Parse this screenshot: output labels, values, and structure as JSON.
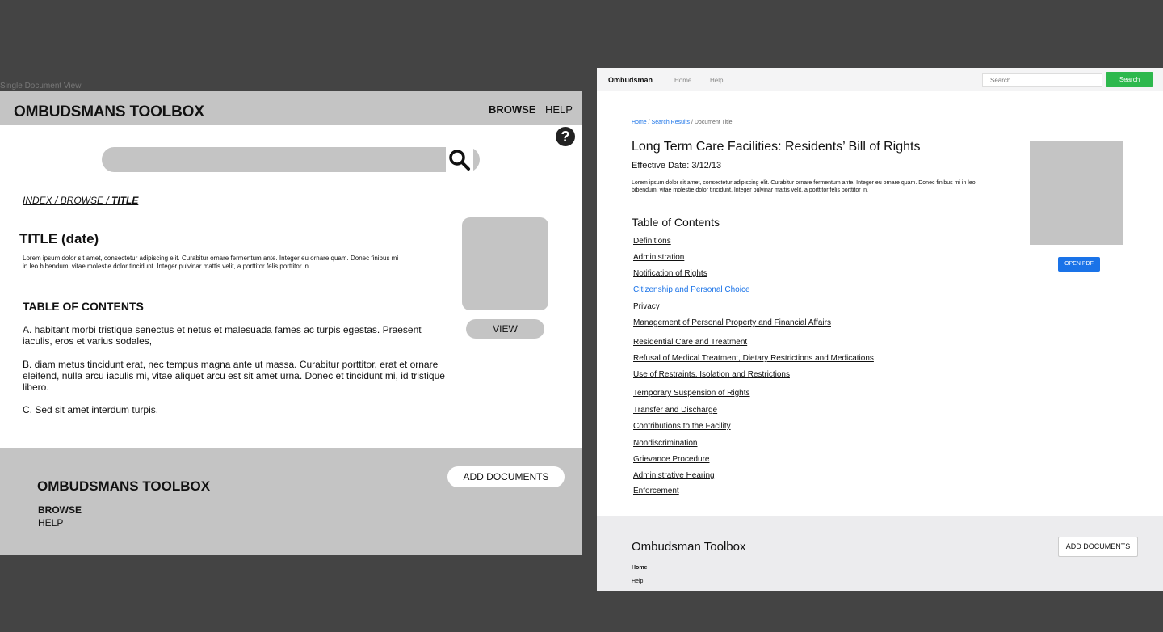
{
  "wireframe": {
    "caption": "Single Document View",
    "header": {
      "logo": "OMBUDSMANS TOOLBOX",
      "nav_browse": "BROWSE",
      "nav_help": "HELP"
    },
    "help_icon_glyph": "?",
    "breadcrumb": {
      "part1": "INDEX / BROWSE / ",
      "current": "TITLE"
    },
    "title": "TITLE (date)",
    "lorem": "Lorem ipsum dolor sit amet, consectetur adipiscing elit. Curabitur ornare fermentum ante. Integer eu ornare quam. Donec finibus mi in leo bibendum, vitae molestie dolor tincidunt. Integer pulvinar mattis velit, a porttitor felis porttitor in.",
    "view_label": "VIEW",
    "toc_heading": "TABLE OF CONTENTS",
    "toc_items": [
      "A. habitant morbi tristique senectus et netus et malesuada fames ac turpis egestas. Praesent iaculis, eros et varius sodales,",
      "B.  diam metus tincidunt erat, nec tempus magna ante ut massa. Curabitur porttitor, erat et ornare eleifend, nulla arcu iaculis mi, vitae aliquet arcu est sit amet urna. Donec et tincidunt mi, id tristique libero.",
      "C.  Sed sit amet interdum turpis."
    ],
    "footer": {
      "logo": "OMBUDSMANS TOOLBOX",
      "browse": "BROWSE",
      "help": "HELP",
      "add_documents": "ADD DOCUMENTS"
    }
  },
  "mockup": {
    "nav": {
      "brand": "Ombudsman",
      "home": "Home",
      "help": "Help",
      "search_placeholder": "Search",
      "search_button": "Search"
    },
    "breadcrumb": {
      "home": "Home",
      "results": "Search Results",
      "current": "Document Title",
      "sep": "/"
    },
    "title": "Long Term Care Facilities: Residents’ Bill of Rights",
    "effective_date": "Effective Date: 3/12/13",
    "lorem": "Lorem ipsum dolor sit amet, consectetur adipiscing elit. Curabitur ornare fermentum ante. Integer eu ornare quam. Donec finibus mi in leo bibendum, vitae molestie dolor tincidunt. Integer pulvinar mattis velit, a porttitor felis porttitor in.",
    "open_pdf": "OPEN PDF",
    "toc_heading": "Table of Contents",
    "toc_links": [
      "Definitions",
      "Administration",
      "Notification of Rights",
      "Citizenship and Personal Choice",
      "Privacy",
      "Management of Personal Property and Financial Affairs",
      "Residential Care and Treatment",
      "Refusal of Medical Treatment, Dietary Restrictions and Medications",
      "Use of Restraints, Isolation and Restrictions",
      "Temporary Suspension of Rights",
      "Transfer and Discharge",
      "Contributions to the Facility",
      "Nondiscrimination",
      "Grievance Procedure",
      "Administrative Hearing",
      "Enforcement"
    ],
    "active_link_index": 3,
    "footer": {
      "brand": "Ombudsman Toolbox",
      "home": "Home",
      "help": "Help",
      "add_documents": "ADD DOCUMENTS"
    }
  },
  "colors": {
    "backdrop": "#444444",
    "wireframe_gray": "#c4c4c4",
    "link_blue": "#1a73e8",
    "search_green": "#2db84d"
  }
}
